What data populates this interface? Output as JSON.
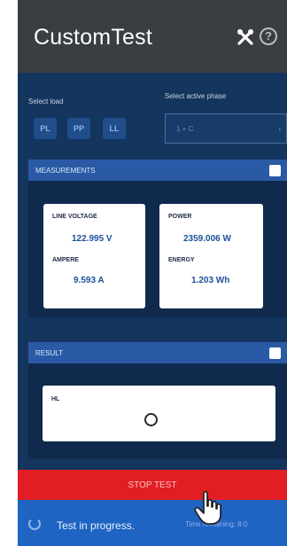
{
  "app": {
    "title": "CustomTest"
  },
  "load": {
    "label": "Select load",
    "options": [
      "PL",
      "PP",
      "LL"
    ]
  },
  "phase": {
    "label": "Select active phase",
    "value": "1 + C",
    "chevron": "›"
  },
  "measurements": {
    "title": "MEASUREMENTS",
    "line_voltage": {
      "label": "LINE VOLTAGE",
      "value": "122.995 V"
    },
    "ampere": {
      "label": "AMPERE",
      "value": "9.593 A"
    },
    "power": {
      "label": "POWER",
      "value": "2359.006 W"
    },
    "energy": {
      "label": "ENERGY",
      "value": "1.203 Wh"
    }
  },
  "result": {
    "title": "RESULT",
    "item_label": "HL"
  },
  "actions": {
    "stop_label": "STOP TEST"
  },
  "status": {
    "text": "Test in progress.",
    "time_remaining": "Time remaining: 8:0"
  },
  "icons": {
    "tools": "tools-icon",
    "help": "help-icon",
    "check": "checkbox-icon",
    "spinner": "loading-spinner-icon",
    "cursor": "hand-pointer-icon"
  },
  "colors": {
    "appbar": "#3a3d42",
    "background": "#14355e",
    "panel_header": "#2a5aa6",
    "stop": "#e21d23",
    "status": "#1f64c2",
    "value_text": "#1c4f9c"
  }
}
